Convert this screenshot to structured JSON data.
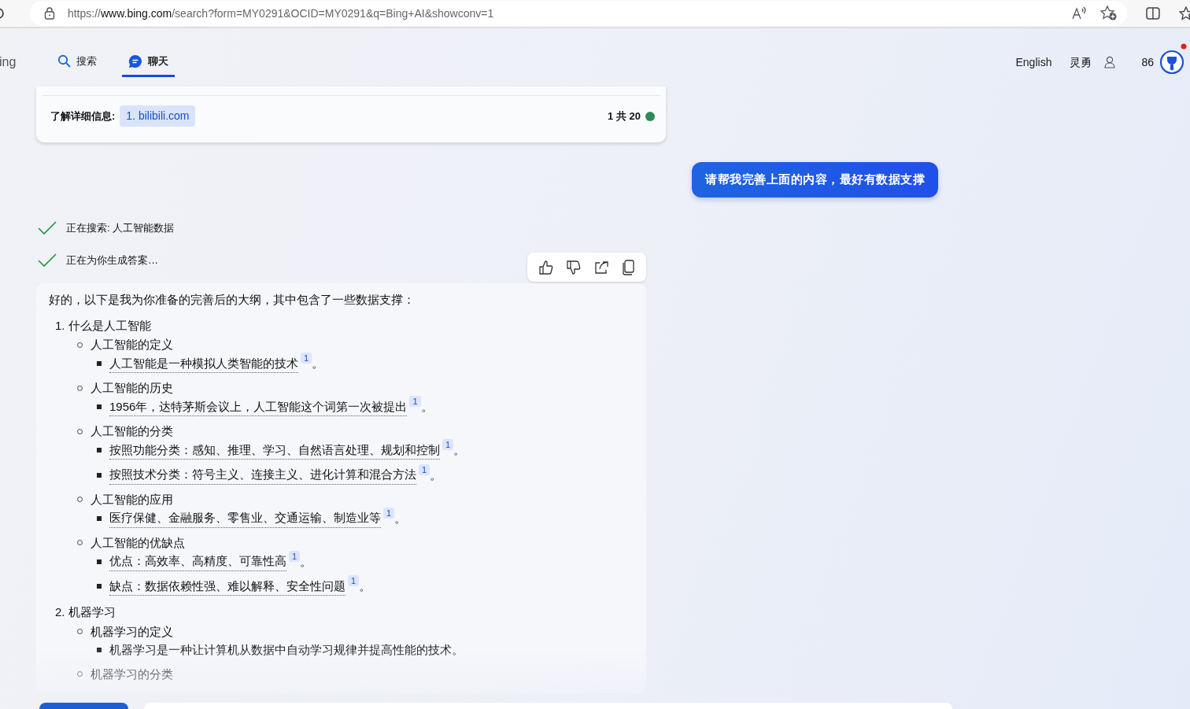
{
  "browser": {
    "url": {
      "scheme": "https://",
      "host": "www.bing.com",
      "rest": "/search?form=MY0291&OCID=MY0291&q=Bing+AI&showconv=1"
    }
  },
  "header": {
    "brand": "ing",
    "tabs": [
      {
        "label": "搜索",
        "selected": false
      },
      {
        "label": "聊天",
        "selected": true
      }
    ],
    "language": "English",
    "user": "灵勇",
    "points": "86"
  },
  "previous_card": {
    "learn_more_label": "了解详细信息:",
    "sources": [
      {
        "label": "1. bilibili.com"
      }
    ],
    "counter": "1 共 20"
  },
  "user_message": "请帮我完善上面的内容，最好有数据支撑",
  "steps": [
    {
      "text": "正在搜索: 人工智能数据",
      "done": true
    },
    {
      "text": "正在为你生成答案…",
      "done": true
    }
  ],
  "answer": {
    "intro": "好的，以下是我为你准备的完善后的大纲，其中包含了一些数据支撑：",
    "outline": [
      {
        "number": "1.",
        "text": "什么是人工智能",
        "children": [
          {
            "text": "人工智能的定义",
            "children": [
              {
                "text": "人工智能是一种模拟人类智能的技术",
                "citation": "1",
                "end": "。"
              }
            ]
          },
          {
            "text": "人工智能的历史",
            "children": [
              {
                "text": "1956年，达特茅斯会议上，人工智能这个词第一次被提出",
                "citation": "1",
                "end": "。"
              }
            ]
          },
          {
            "text": "人工智能的分类",
            "children": [
              {
                "text": "按照功能分类：感知、推理、学习、自然语言处理、规划和控制",
                "citation": "1",
                "end": "。"
              },
              {
                "text": "按照技术分类：符号主义、连接主义、进化计算和混合方法",
                "citation": "1",
                "end": "。"
              }
            ]
          },
          {
            "text": "人工智能的应用",
            "children": [
              {
                "text": "医疗保健、金融服务、零售业、交通运输、制造业等",
                "citation": "1",
                "end": "。"
              }
            ]
          },
          {
            "text": "人工智能的优缺点",
            "children": [
              {
                "text": "优点：高效率、高精度、可靠性高",
                "citation": "1",
                "end": "。"
              },
              {
                "text": "缺点：数据依赖性强、难以解释、安全性问题",
                "citation": "1",
                "end": "。"
              }
            ]
          }
        ]
      },
      {
        "number": "2.",
        "text": "机器学习",
        "children": [
          {
            "text": "机器学习的定义",
            "children": [
              {
                "text": "机器学习是一种让计算机从数据中自动学习规律并提高性能的技术。"
              }
            ]
          },
          {
            "text": "机器学习的分类"
          }
        ]
      }
    ]
  }
}
